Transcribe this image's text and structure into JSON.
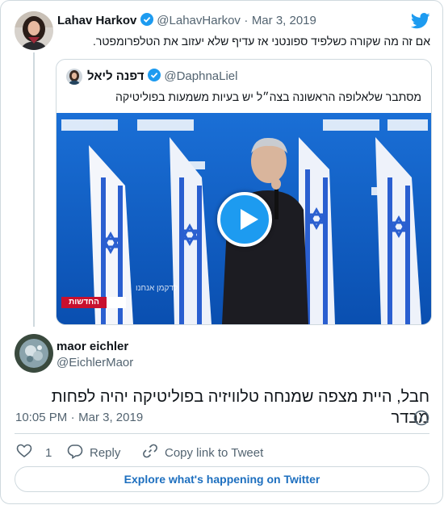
{
  "original_tweet": {
    "author_name": "Lahav Harkov",
    "handle": "@LahavHarkov",
    "separator": "·",
    "date": "Mar 3, 2019",
    "text": "אם זה מה שקורה כשלפיד ספונטני אז עדיף שלא יעזוב את הטלפרומפטר."
  },
  "quoted_tweet": {
    "author_name": "דפנה ליאל",
    "handle": "@DaphnaLiel",
    "text": "מסתבר שלאלופה הראשונה בצה״ל יש בעיות משמעות בפוליטיקה",
    "video_caption": "החדשות",
    "video_lower_text": "לדקמן אנחנו"
  },
  "reply_tweet": {
    "author_name": "maor eichler",
    "handle": "@EichlerMaor",
    "text": "חבל, היית מצפה שמנחה טלוויזיה בפוליטיקה יהיה לפחות מבדר",
    "time": "10:05 PM",
    "separator": "·",
    "date": "Mar 3, 2019"
  },
  "actions": {
    "like_count": "1",
    "reply_label": "Reply",
    "copy_link_label": "Copy link to Tweet"
  },
  "explore_label": "Explore what's happening on Twitter",
  "colors": {
    "twitter_blue": "#1d9bf0",
    "like_red": "#f91880",
    "border": "#cfd9de",
    "muted": "#536471"
  },
  "icons": [
    "twitter-bird-icon",
    "verified-icon",
    "play-icon",
    "info-icon",
    "heart-icon",
    "reply-icon",
    "link-icon"
  ]
}
